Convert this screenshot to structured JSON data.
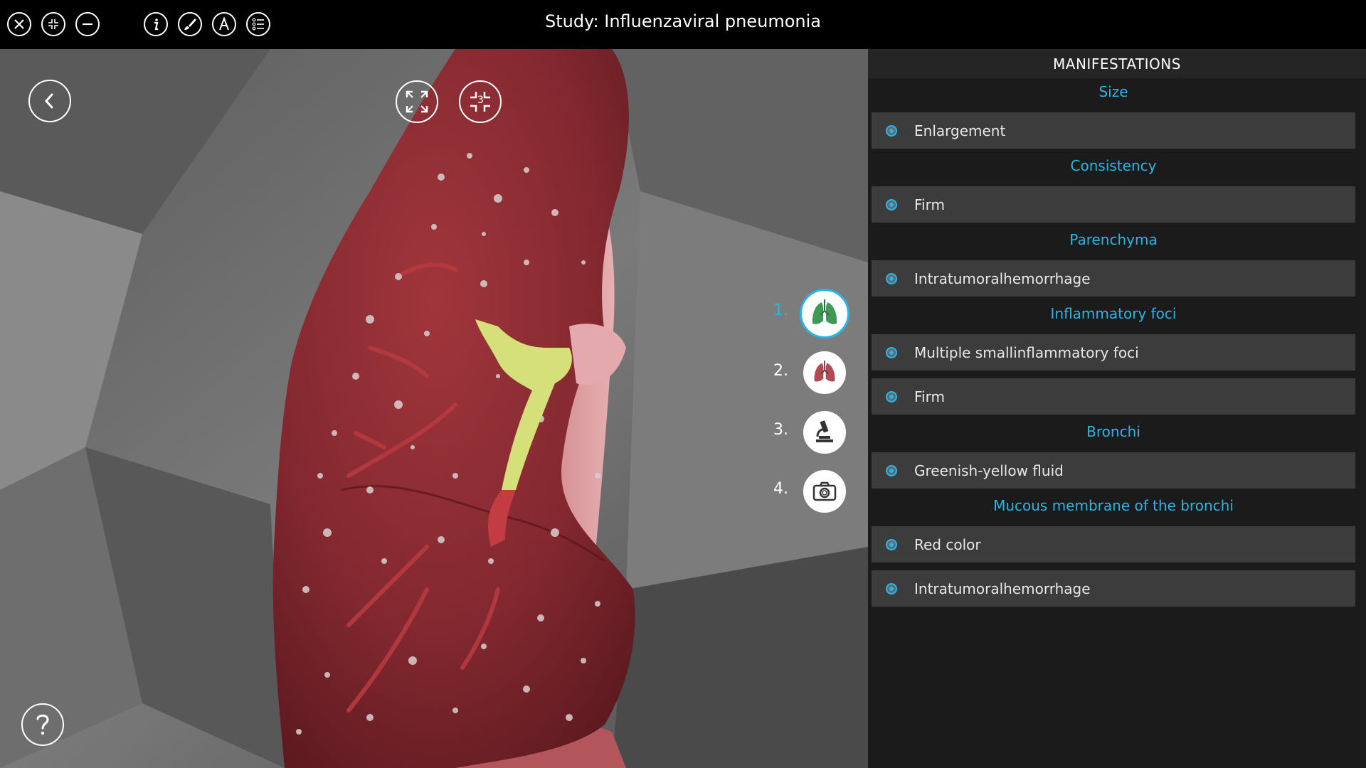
{
  "app": {
    "title": "Study: Influenzaviral pneumonia"
  },
  "toolbar": {
    "left_icons": [
      "close-icon",
      "collapse-icon",
      "minimize-icon"
    ],
    "tool_icons": [
      "info-icon",
      "brush-icon",
      "annotation-icon",
      "list-icon"
    ]
  },
  "viewport": {
    "view_buttons": [
      "expand-view-icon",
      "compress-view-icon"
    ],
    "compress_badge": "3",
    "steps": [
      {
        "label": "1.",
        "icon": "lung-green-icon",
        "active": true
      },
      {
        "label": "2.",
        "icon": "lung-red-icon",
        "active": false
      },
      {
        "label": "3.",
        "icon": "microscope-icon",
        "active": false
      },
      {
        "label": "4.",
        "icon": "camera-icon",
        "active": false
      }
    ]
  },
  "panel": {
    "header": "MANIFESTATIONS",
    "sections": [
      {
        "title": "Size",
        "items": [
          "Enlargement"
        ]
      },
      {
        "title": "Consistency",
        "items": [
          "Firm"
        ]
      },
      {
        "title": "Parenchyma",
        "items": [
          "Intratumoralhemorrhage"
        ]
      },
      {
        "title": "Inflammatory foci",
        "items": [
          "Multiple smallinflammatory foci",
          "Firm"
        ]
      },
      {
        "title": "Bronchi",
        "items": [
          "Greenish-yellow fluid"
        ]
      },
      {
        "title": "Mucous membrane of the bronchi",
        "items": [
          "Red color",
          "Intratumoralhemorrhage"
        ]
      }
    ]
  },
  "colors": {
    "accent": "#2ab5e8",
    "panel_bg": "#1b1b1b",
    "item_bg": "#3c3c3c",
    "lung": "#8b2a30",
    "fluid": "#d8e27a"
  }
}
